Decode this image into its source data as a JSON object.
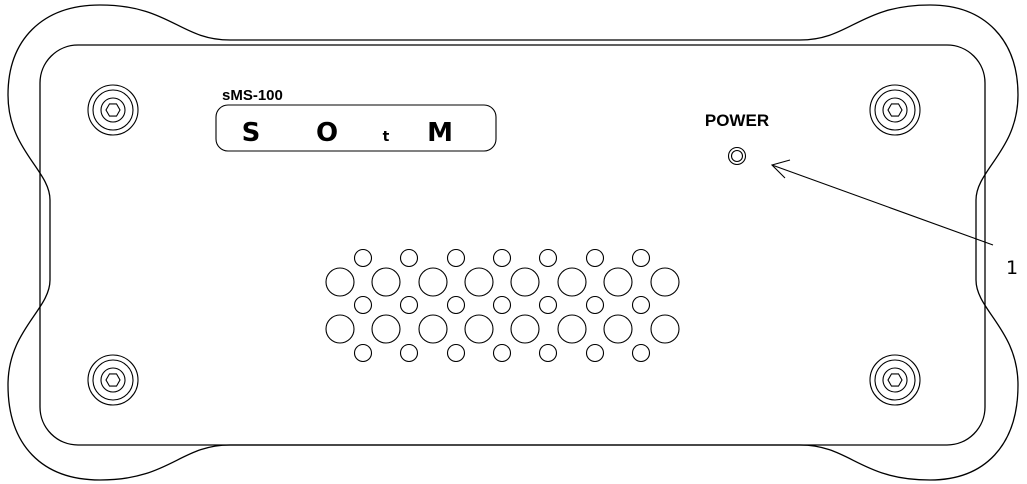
{
  "device": {
    "model_label": "sMS-100",
    "logo": {
      "letters": [
        "S",
        "O",
        "t",
        "M"
      ]
    },
    "power_label": "POWER",
    "callout_number": "1"
  }
}
